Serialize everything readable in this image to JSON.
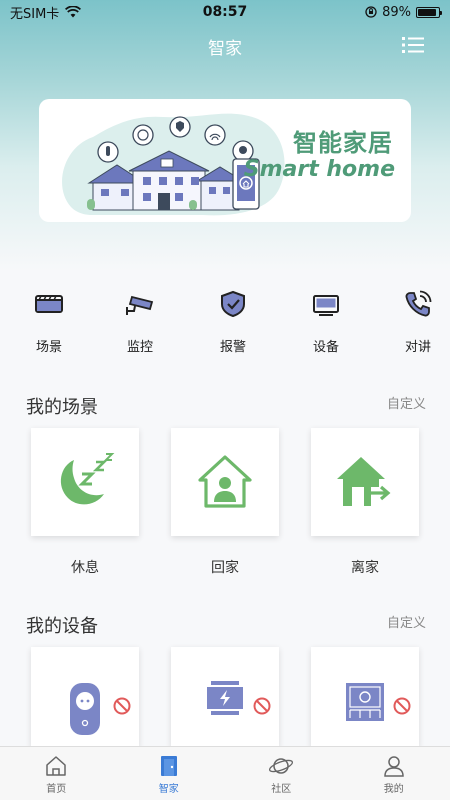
{
  "status_bar": {
    "carrier": "无SIM卡",
    "time": "08:57",
    "battery_text": "89%",
    "battery_level": 0.89
  },
  "header": {
    "title": "智家"
  },
  "banner": {
    "title_cn": "智能家居",
    "title_en": "Smart home"
  },
  "quick_menu": [
    {
      "label": "场景",
      "icon": "film-icon"
    },
    {
      "label": "监控",
      "icon": "camera-icon"
    },
    {
      "label": "报警",
      "icon": "shield-check-icon"
    },
    {
      "label": "设备",
      "icon": "monitor-icon"
    },
    {
      "label": "对讲",
      "icon": "phone-call-icon"
    }
  ],
  "scenes": {
    "title": "我的场景",
    "customize": "自定义",
    "items": [
      {
        "label": "休息",
        "icon": "moon-sleep-icon"
      },
      {
        "label": "回家",
        "icon": "home-person-icon"
      },
      {
        "label": "离家",
        "icon": "home-exit-icon"
      }
    ]
  },
  "devices": {
    "title": "我的设备",
    "customize": "自定义",
    "items": [
      {
        "icon": "socket-icon"
      },
      {
        "icon": "power-switch-icon"
      },
      {
        "icon": "panel-switch-icon"
      }
    ]
  },
  "tabs": [
    {
      "label": "首页",
      "icon": "home-icon"
    },
    {
      "label": "智家",
      "icon": "door-icon",
      "active": true
    },
    {
      "label": "社区",
      "icon": "planet-icon"
    },
    {
      "label": "我的",
      "icon": "user-icon"
    }
  ],
  "colors": {
    "accent": "#3a7bd5",
    "scene_green": "#6db86a",
    "device_purple": "#7b86c6",
    "banner_green": "#4f9b78"
  }
}
